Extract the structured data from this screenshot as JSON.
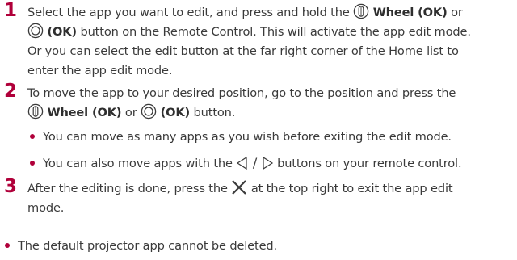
{
  "steps": [
    {
      "number": "1",
      "line1_prefix": "Select the app you want to edit, and press and hold the",
      "wheel_ok": "Wheel (OK)",
      "line1_or": "or",
      "ok": "(OK)",
      "line2_rest": "button on the Remote Control. This will activate the app edit mode.",
      "line3": "Or you can select the edit button at the far right corner of the Home list to",
      "line4": "enter the app edit mode."
    },
    {
      "number": "2",
      "line1": "To move the app to your desired position, go to the position and press the",
      "wheel_ok": "Wheel (OK)",
      "or": "or",
      "ok": "(OK)",
      "button_word": "button.",
      "bullets": [
        "You can move as many apps as you wish before exiting the edit mode.",
        "You can also move apps with the",
        "buttons on your remote control."
      ]
    },
    {
      "number": "3",
      "line1_prefix": "After the editing is done, press the",
      "line1_suffix": "at the top right to exit the app edit",
      "line2": "mode."
    }
  ],
  "note": "The default projector app cannot be deleted.",
  "icons": [
    "wheel-icon",
    "ok-button-icon",
    "left-arrow-icon",
    "right-arrow-icon",
    "close-x-icon"
  ],
  "colors": {
    "accent": "#b0003a",
    "text": "#3a3a3a"
  }
}
